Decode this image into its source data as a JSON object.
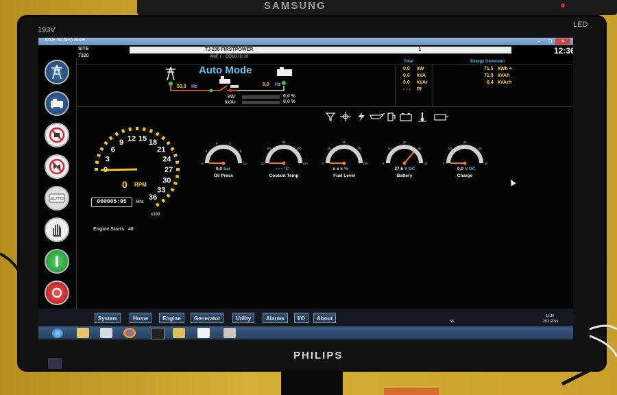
{
  "monitor": {
    "top_brand": "SAMSUNG",
    "model": "193V",
    "led_label": "LED",
    "brand": "PHILIPS"
  },
  "window": {
    "title": "DSE SCADA Suite",
    "min": "–",
    "max": "□",
    "close": "✕"
  },
  "header": {
    "site_label": "SITE",
    "site_id": "7320",
    "name": "TJ 235 FIRSTPOWER",
    "page": "1",
    "mode_line": "AMF 1 - COM2 ID:10",
    "clock": "12:36"
  },
  "mimic": {
    "title": "Auto Mode",
    "mains_hz": "50,0",
    "gen_hz": "0,0",
    "hz_unit": "Hz",
    "kw_label": "kW",
    "kvar_label": "kVAr",
    "kw_pct": "0,0 %",
    "kvar_pct": "0,0 %"
  },
  "total": {
    "title": "Total",
    "rows": [
      {
        "value": "0,0",
        "unit": "kW"
      },
      {
        "value": "0,0",
        "unit": "kVA"
      },
      {
        "value": "0,0",
        "unit": "kVAr"
      },
      {
        "value": "- - -",
        "unit": "Pf"
      }
    ]
  },
  "energy": {
    "title": "Energy Generator",
    "rows": [
      {
        "value": "71,5",
        "unit": "kWh +"
      },
      {
        "value": "71,0",
        "unit": "kVAh"
      },
      {
        "value": "6,4",
        "unit": "kVArh"
      }
    ]
  },
  "tach": {
    "ticks": [
      "0",
      "3",
      "6",
      "9",
      "12",
      "15",
      "18",
      "21",
      "24",
      "27",
      "30",
      "33",
      "36"
    ],
    "rpm_value": "0",
    "rpm_unit": "RPM",
    "multiplier": "x100",
    "hours_value": "000005:05",
    "hours_unit": "Hrs",
    "starts_label": "Engine Starts",
    "starts_value": "48"
  },
  "gauges": [
    {
      "value": "0,0",
      "unit": "bar",
      "label": "Oil Press",
      "level": 0.0,
      "ticks": [
        "0",
        "2",
        "4",
        "6",
        "8",
        "10"
      ]
    },
    {
      "value": "- - -",
      "unit": "°C",
      "label": "Coolant Temp",
      "level": 0.0,
      "ticks": [
        "40",
        "60",
        "80",
        "100",
        "120"
      ]
    },
    {
      "value": "x x x",
      "unit": "%",
      "label": "Fuel Level",
      "level": 0.0,
      "ticks": [
        "0",
        "25",
        "50",
        "75",
        "100"
      ]
    },
    {
      "value": "27,6",
      "unit": "V DC",
      "label": "Battery",
      "level": 0.72,
      "ticks": [
        "0",
        "10",
        "20",
        "30",
        "40"
      ]
    },
    {
      "value": "0,0",
      "unit": "V DC",
      "label": "Charge",
      "level": 0.0,
      "ticks": [
        "0",
        "10",
        "20",
        "30",
        "40"
      ]
    }
  ],
  "nav": [
    "System",
    "Home",
    "Engine",
    "Generator",
    "Utility",
    "Alarms",
    "I/O",
    "About"
  ],
  "tray": {
    "lang": "SK",
    "time": "11:39",
    "date": "28.1.2015"
  },
  "colors": {
    "accent": "#5cc6f5",
    "value": "#ffd53a",
    "needle": "#ff7a1a",
    "gauge_arc": "#d0d0d0"
  },
  "sidebar_icons": [
    "tower-icon",
    "generator-icon",
    "no-auto-icon",
    "no-manual-icon",
    "auto-button-icon",
    "stop-hand-icon",
    "start-icon",
    "stop-icon"
  ],
  "status_icons": [
    "filter-icon",
    "fan-icon",
    "lightning-icon",
    "oil-can-icon",
    "fuel-icon",
    "battery-icon",
    "thermometer-icon",
    "engine-icon"
  ]
}
